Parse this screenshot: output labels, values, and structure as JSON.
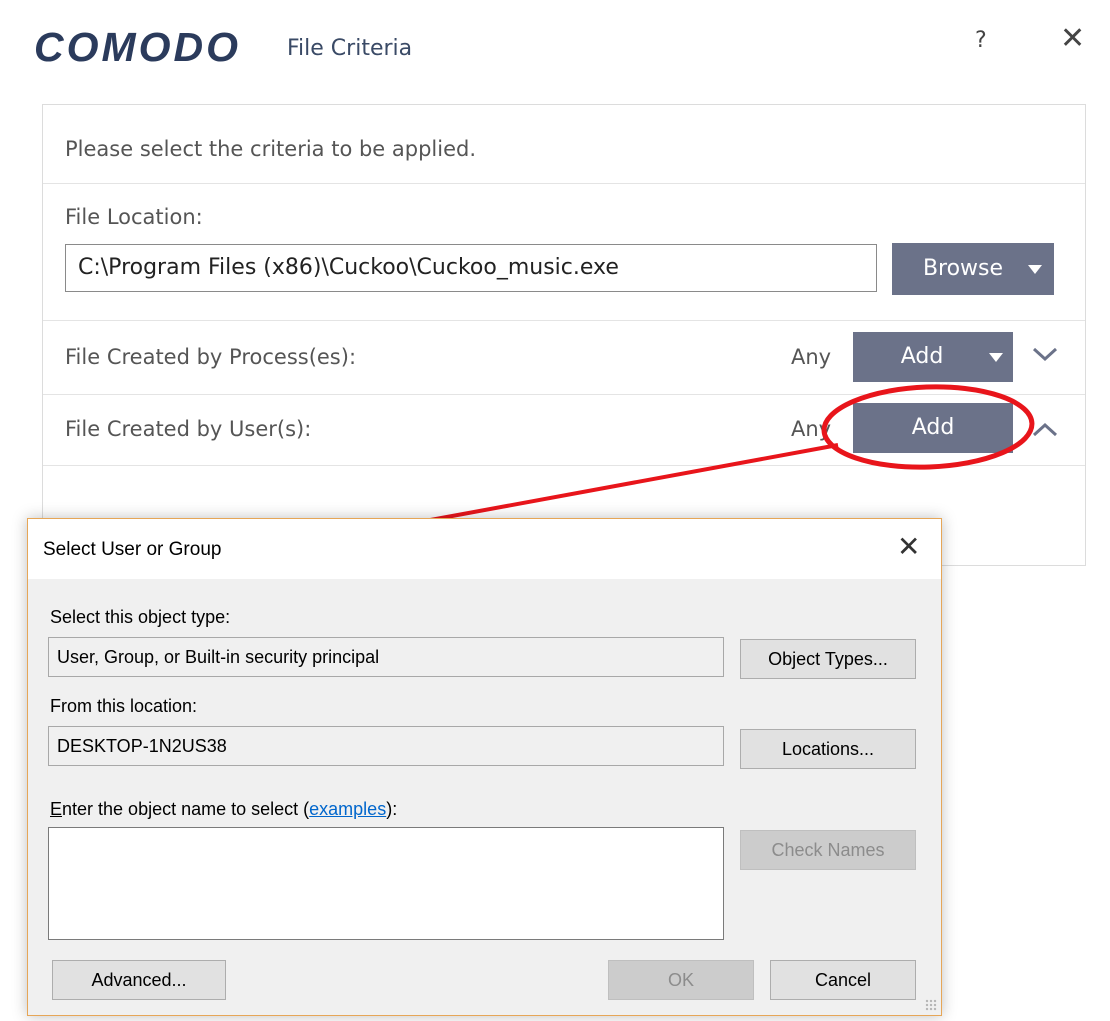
{
  "window": {
    "brand": "COMODO",
    "title": "File Criteria",
    "help_label": "?",
    "close_label": "✕"
  },
  "panel": {
    "intro": "Please select the criteria to be applied.",
    "file_location_label": "File Location:",
    "file_location_value": "C:\\Program Files (x86)\\Cuckoo\\Cuckoo_music.exe",
    "browse_label": "Browse",
    "process_label": "File Created by Process(es):",
    "process_any": "Any",
    "process_add_label": "Add",
    "user_label": "File Created by User(s):",
    "user_any": "Any",
    "user_add_label": "Add"
  },
  "annotation": {
    "color": "#e8151b"
  },
  "dialog": {
    "title": "Select User or Group",
    "close_label": "✕",
    "object_type_label": "Select this object type:",
    "object_type_value": "User, Group, or Built-in security principal",
    "object_types_button": "Object Types...",
    "location_label": "From this location:",
    "location_value": "DESKTOP-1N2US38",
    "locations_button": "Locations...",
    "enter_name_first_letter": "E",
    "enter_name_label": "nter the object name to select (",
    "examples_link": "examples",
    "enter_name_suffix": "):",
    "check_names_button": "Check Names",
    "advanced_button": "Advanced...",
    "ok_button": "OK",
    "cancel_button": "Cancel"
  },
  "colors": {
    "brand_navy": "#2b3b5c",
    "button_slate": "#6b7289",
    "dialog_border": "#e6a657",
    "link_blue": "#0066cc"
  }
}
